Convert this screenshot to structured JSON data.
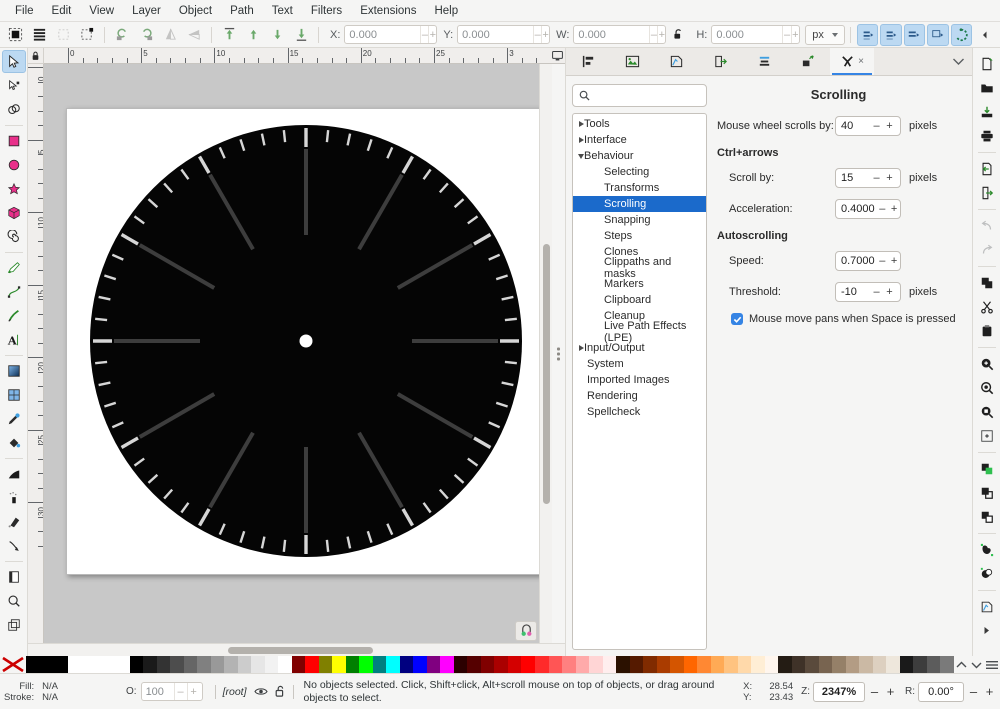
{
  "menubar": {
    "items": [
      "File",
      "Edit",
      "View",
      "Layer",
      "Object",
      "Path",
      "Text",
      "Filters",
      "Extensions",
      "Help"
    ]
  },
  "toolbar": {
    "x_label": "X:",
    "x_value": "0.000",
    "y_label": "Y:",
    "y_value": "0.000",
    "w_label": "W:",
    "w_value": "0.000",
    "h_label": "H:",
    "h_value": "0.000",
    "unit": "px",
    "minus": "–",
    "plus": "+",
    "icons": [
      "select-all-icon",
      "select-all-layers-icon",
      "deselect-icon",
      "select-same-icon",
      "rotate-ccw-icon",
      "rotate-cw-icon",
      "flip-horizontal-icon",
      "flip-vertical-icon",
      "raise-to-top-icon",
      "raise-icon",
      "lower-icon",
      "lower-to-bottom-icon"
    ],
    "lock_icon": "lock-open-icon",
    "toggles": [
      "affect-transform-icon",
      "affect-pattern-icon",
      "affect-rounded-corners-icon",
      "affect-gradient-icon"
    ],
    "snap_icon": "snap-enable-icon",
    "collapse_icon": "chevron-left-icon"
  },
  "toolbox": {
    "tools": [
      {
        "name": "selector-tool",
        "active": true
      },
      {
        "name": "node-tool",
        "active": false
      },
      {
        "name": "shape-builder-tool",
        "active": false
      },
      {
        "name": "rectangle-tool",
        "active": false
      },
      {
        "name": "ellipse-tool",
        "active": false
      },
      {
        "name": "star-tool",
        "active": false
      },
      {
        "name": "3dbox-tool",
        "active": false
      },
      {
        "name": "spiral-tool",
        "active": false
      },
      {
        "name": "pencil-tool",
        "active": false
      },
      {
        "name": "bezier-tool",
        "active": false
      },
      {
        "name": "calligraphy-tool",
        "active": false
      },
      {
        "name": "text-tool",
        "active": false
      },
      {
        "name": "gradient-tool",
        "active": false
      },
      {
        "name": "mesh-tool",
        "active": false
      },
      {
        "name": "dropper-tool",
        "active": false
      },
      {
        "name": "paintbucket-tool",
        "active": false
      },
      {
        "name": "tweak-tool",
        "active": false
      },
      {
        "name": "spray-tool",
        "active": false
      },
      {
        "name": "eraser-tool",
        "active": false
      },
      {
        "name": "connector-tool",
        "active": false
      },
      {
        "name": "pages-tool",
        "active": false
      },
      {
        "name": "zoom-tool",
        "active": false
      },
      {
        "name": "measure-tool",
        "active": false
      }
    ]
  },
  "commandbar": {
    "commands": [
      "new-document-icon",
      "open-document-icon",
      "save-document-icon",
      "print-icon",
      "import-icon",
      "export-icon",
      "undo-icon",
      "redo-icon",
      "copy-icon",
      "cut-icon",
      "paste-icon",
      "zoom-in-icon",
      "zoom-out-icon",
      "zoom-selection-icon",
      "zoom-drawing-icon",
      "duplicate-icon",
      "group-icon",
      "ungroup-icon",
      "union-icon",
      "difference-icon",
      "xml-editor-icon",
      "more-icon"
    ]
  },
  "canvas": {
    "ruler_h_labels": [
      "0",
      "5",
      "10",
      "15",
      "20",
      "25",
      "3"
    ],
    "ruler_v_labels": [
      "0",
      "5",
      "10",
      "15",
      "20",
      "25",
      "30"
    ],
    "lock_icon": "lock-ruler-icon",
    "display_icon": "display-mode-icon",
    "snap_icon": "snap-bar-icon",
    "drawing": {
      "name": "clock-face",
      "background": "#ffffff",
      "disc_color": "#050505",
      "hour_mark_color": "#3d3d3d",
      "minute_mark_color": "#d6d6d6",
      "center_dot_color": "#ffffff",
      "hour_marks": 12,
      "minute_marks": 60
    }
  },
  "dock": {
    "tabs": [
      {
        "name": "align-and-distribute",
        "icon": "align-icon",
        "active": false
      },
      {
        "name": "document-resources",
        "icon": "image-icon",
        "active": false
      },
      {
        "name": "text-and-font",
        "icon": "edit-icon",
        "active": false
      },
      {
        "name": "export",
        "icon": "export-icon",
        "active": false
      },
      {
        "name": "layers",
        "icon": "layers-icon",
        "active": false
      },
      {
        "name": "objects",
        "icon": "objects-icon",
        "active": false
      },
      {
        "name": "preferences",
        "icon": "preferences-icon",
        "active": true,
        "close": "×"
      }
    ],
    "menu_icon": "chevron-down-icon"
  },
  "preferences": {
    "search_placeholder": "",
    "search_value": "",
    "search_icon": "search-icon",
    "tree": [
      {
        "label": "Tools",
        "depth": 0,
        "arrow": "right",
        "selected": false
      },
      {
        "label": "Interface",
        "depth": 0,
        "arrow": "right",
        "selected": false
      },
      {
        "label": "Behaviour",
        "depth": 0,
        "arrow": "down",
        "selected": false
      },
      {
        "label": "Selecting",
        "depth": 1,
        "arrow": "none",
        "selected": false
      },
      {
        "label": "Transforms",
        "depth": 1,
        "arrow": "none",
        "selected": false
      },
      {
        "label": "Scrolling",
        "depth": 1,
        "arrow": "none",
        "selected": true
      },
      {
        "label": "Snapping",
        "depth": 1,
        "arrow": "none",
        "selected": false
      },
      {
        "label": "Steps",
        "depth": 1,
        "arrow": "none",
        "selected": false
      },
      {
        "label": "Clones",
        "depth": 1,
        "arrow": "none",
        "selected": false
      },
      {
        "label": "Clippaths and masks",
        "depth": 1,
        "arrow": "none",
        "selected": false
      },
      {
        "label": "Markers",
        "depth": 1,
        "arrow": "none",
        "selected": false
      },
      {
        "label": "Clipboard",
        "depth": 1,
        "arrow": "none",
        "selected": false
      },
      {
        "label": "Cleanup",
        "depth": 1,
        "arrow": "none",
        "selected": false
      },
      {
        "label": "Live Path Effects (LPE)",
        "depth": 1,
        "arrow": "none",
        "selected": false
      },
      {
        "label": "Input/Output",
        "depth": 0,
        "arrow": "right",
        "selected": false
      },
      {
        "label": "System",
        "depth": 0,
        "arrow": "none",
        "selected": false
      },
      {
        "label": "Imported Images",
        "depth": 0,
        "arrow": "none",
        "selected": false
      },
      {
        "label": "Rendering",
        "depth": 0,
        "arrow": "none",
        "selected": false
      },
      {
        "label": "Spellcheck",
        "depth": 0,
        "arrow": "none",
        "selected": false
      }
    ],
    "page_title": "Scrolling",
    "mouse_wheel": {
      "label": "Mouse wheel scrolls by:",
      "value": "40",
      "unit": "pixels"
    },
    "ctrl_arrows_group": "Ctrl+arrows",
    "scroll_by": {
      "label": "Scroll by:",
      "value": "15",
      "unit": "pixels"
    },
    "acceleration": {
      "label": "Acceleration:",
      "value": "0.4000",
      "unit": ""
    },
    "autoscrolling_group": "Autoscrolling",
    "speed": {
      "label": "Speed:",
      "value": "0.7000",
      "unit": ""
    },
    "threshold": {
      "label": "Threshold:",
      "value": "-10",
      "unit": "pixels"
    },
    "space_pan": {
      "label": "Mouse move pans when Space is pressed",
      "checked": true
    },
    "minus": "–",
    "plus": "+"
  },
  "palette": {
    "colors": [
      "#ffffff",
      "#000000",
      "#1a1a1a",
      "#333333",
      "#4d4d4d",
      "#666666",
      "#808080",
      "#999999",
      "#b3b3b3",
      "#cccccc",
      "#e6e6e6",
      "#f2f2f2",
      "#ffffff",
      "#800000",
      "#ff0000",
      "#808000",
      "#ffff00",
      "#008000",
      "#00ff00",
      "#008080",
      "#00ffff",
      "#000080",
      "#0000ff",
      "#800080",
      "#ff00ff",
      "#2b0000",
      "#550000",
      "#800000",
      "#aa0000",
      "#d40000",
      "#ff0000",
      "#ff2a2a",
      "#ff5555",
      "#ff8080",
      "#ffaaaa",
      "#ffd5d5",
      "#ffeeee",
      "#2b1100",
      "#551a00",
      "#802b00",
      "#aa3c00",
      "#d45500",
      "#ff6600",
      "#ff8833",
      "#ffaa55",
      "#ffc380",
      "#ffd9aa",
      "#ffeed5",
      "#fff6ee",
      "#241c14",
      "#3f3228",
      "#5a4a3c",
      "#786450",
      "#958068",
      "#b39c84",
      "#cbb9a4",
      "#ddd0c0",
      "#eee7dc",
      "#1a1a1a",
      "#3d3d3d",
      "#5c5c5c",
      "#7a7a7a"
    ],
    "scroll_up_icon": "chevron-up-icon",
    "scroll_down_icon": "chevron-down-icon",
    "menu_icon": "palette-menu-icon"
  },
  "statusbar": {
    "fill_label": "Fill:",
    "fill_value": "N/A",
    "stroke_label": "Stroke:",
    "stroke_value": "N/A",
    "opacity_label": "O:",
    "opacity_value": "100",
    "layer_name": "[root]",
    "layer_visibility_icon": "eye-icon",
    "layer_lock_icon": "lock-open-icon",
    "message": "No objects selected. Click, Shift+click, Alt+scroll mouse on top of objects, or drag around objects to select.",
    "x_label": "X:",
    "x_value": "28.54",
    "y_label": "Y:",
    "y_value": "23.43",
    "zoom_label": "Z:",
    "zoom_value": "2347%",
    "rotation_label": "R:",
    "rotation_value": "0.00°",
    "minus": "–",
    "plus": "+"
  }
}
